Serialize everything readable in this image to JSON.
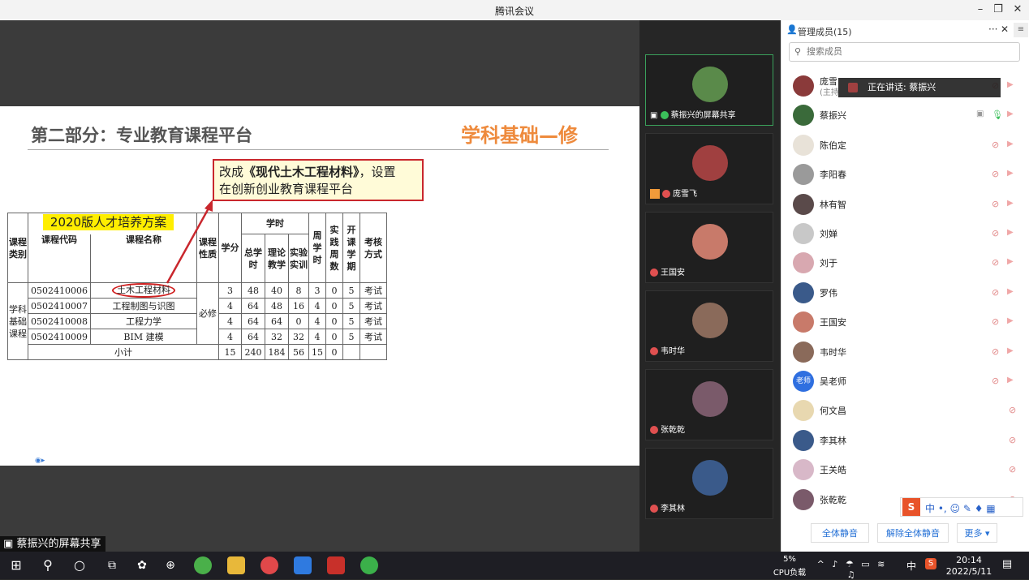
{
  "window": {
    "title": "腾讯会议"
  },
  "slide": {
    "heading": "第二部分：专业教育课程平台",
    "subject": "学科基础—修",
    "callout_line1_a": "改成",
    "callout_line1_b": "《现代土木工程材料》",
    "callout_line1_c": "，设置",
    "callout_line2": "在创新创业教育课程平台",
    "plan_title": "2020版人才培养方案",
    "table": {
      "h_category": "课程类别",
      "h_code": "课程代码",
      "h_name": "课程名称",
      "h_nature": "课程性质",
      "h_credit": "学分",
      "h_hours": "学时",
      "h_total": "总学时",
      "h_theory": "理论教学",
      "h_practice": "实验实训",
      "h_weekly": "周学时",
      "h_pweeks": "实践周数",
      "h_term": "开课学期",
      "h_exam": "考核方式",
      "category": "学科基础课程",
      "nature": "必修",
      "rows": [
        {
          "code": "0502410006",
          "name": "土木工程材料",
          "credit": "3",
          "total": "48",
          "theory": "40",
          "practice": "8",
          "weekly": "3",
          "pweeks": "0",
          "term": "5",
          "exam": "考试"
        },
        {
          "code": "0502410007",
          "name": "工程制图与识图",
          "credit": "4",
          "total": "64",
          "theory": "48",
          "practice": "16",
          "weekly": "4",
          "pweeks": "0",
          "term": "5",
          "exam": "考试"
        },
        {
          "code": "0502410008",
          "name": "工程力学",
          "credit": "4",
          "total": "64",
          "theory": "64",
          "practice": "0",
          "weekly": "4",
          "pweeks": "0",
          "term": "5",
          "exam": "考试"
        },
        {
          "code": "0502410009",
          "name": "BIM 建模",
          "credit": "4",
          "total": "64",
          "theory": "32",
          "practice": "32",
          "weekly": "4",
          "pweeks": "0",
          "term": "5",
          "exam": "考试"
        }
      ],
      "subtotal": {
        "label": "小计",
        "credit": "15",
        "total": "240",
        "theory": "184",
        "practice": "56",
        "weekly": "15",
        "pweeks": "0"
      }
    }
  },
  "share_label": "蔡振兴的屏幕共享",
  "videos": [
    {
      "name": "蔡振兴的屏幕共享",
      "color": "#5a8a4a",
      "active": true
    },
    {
      "name": "庞雪飞",
      "color": "#a04040"
    },
    {
      "name": "王国安",
      "color": "#c87a6a"
    },
    {
      "name": "韦时华",
      "color": "#8a6a5a"
    },
    {
      "name": "张乾乾",
      "color": "#7a5a6a"
    },
    {
      "name": "李其林",
      "color": "#3a5a8a"
    }
  ],
  "panel": {
    "title": "管理成员(15)",
    "search_placeholder": "搜索成员",
    "speaking": "正在讲话: 蔡振兴",
    "host_sub": "(主持",
    "members": [
      {
        "name": "庞雪",
        "color": "#8a3a3a"
      },
      {
        "name": "蔡振兴",
        "color": "#3a6a3a"
      },
      {
        "name": "陈伯定",
        "color": "#e8e2d8"
      },
      {
        "name": "李阳春",
        "color": "#9a9a9a"
      },
      {
        "name": "林有智",
        "color": "#5a4a4a"
      },
      {
        "name": "刘婵",
        "color": "#c8c8c8"
      },
      {
        "name": "刘于",
        "color": "#d8a8b0"
      },
      {
        "name": "罗伟",
        "color": "#3a5a8a"
      },
      {
        "name": "王国安",
        "color": "#c87a6a"
      },
      {
        "name": "韦时华",
        "color": "#8a6a5a"
      },
      {
        "name": "吴老师",
        "color": "#2f6fe0",
        "label": "老师"
      },
      {
        "name": "何文昌",
        "color": "#e8d8b0"
      },
      {
        "name": "李其林",
        "color": "#3a5a8a"
      },
      {
        "name": "王关皓",
        "color": "#d8b8c8"
      },
      {
        "name": "张乾乾",
        "color": "#7a5a6a"
      }
    ],
    "mute_all": "全体静音",
    "unmute_all": "解除全体静音",
    "more": "更多 ▾",
    "ime": "中 •, ☺ ✎ ♦ ▦"
  },
  "taskbar": {
    "cpu_pct": "5%",
    "cpu_label": "CPU负载",
    "ime": "中",
    "time": "20:14",
    "date": "2022/5/11"
  },
  "colors": {
    "accent": "#3aa05b",
    "callout_border": "#c9272d",
    "subject": "#ee8a3c"
  }
}
